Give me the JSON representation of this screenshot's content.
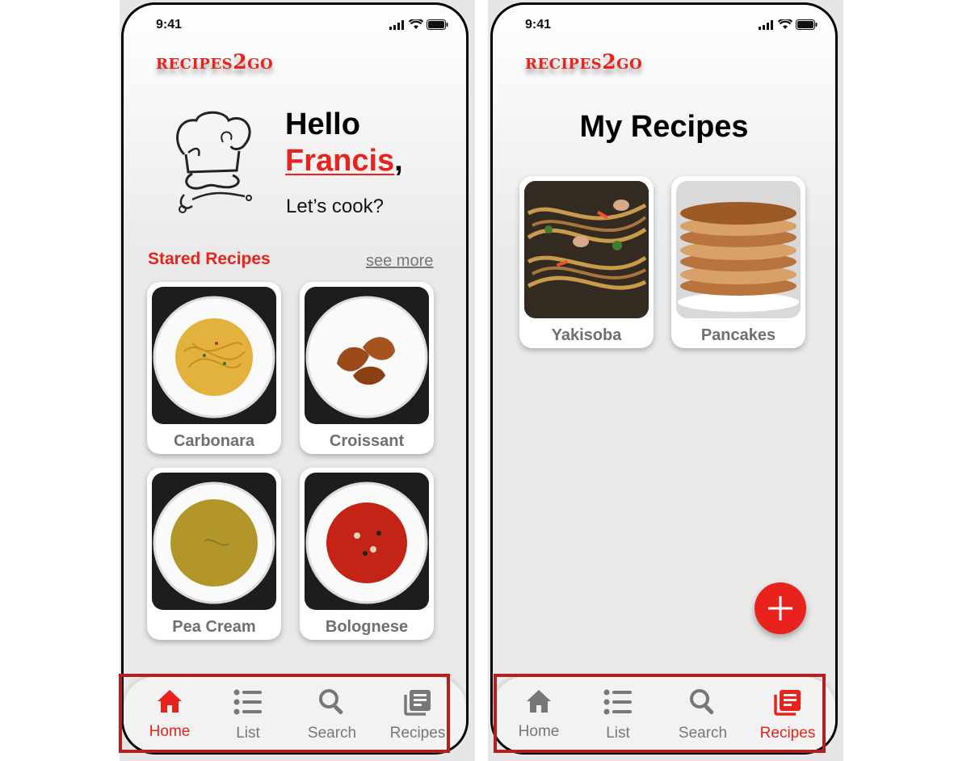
{
  "colors": {
    "accent": "#e8231d",
    "inactive": "#777777",
    "highlight_box": "#b21f1f"
  },
  "home_screen": {
    "status": {
      "time": "9:41"
    },
    "logo": {
      "prefix": "RECIPES",
      "digit": "2",
      "suffix": "GO"
    },
    "greeting": {
      "hello": "Hello",
      "name": "Francis",
      "comma": ",",
      "subtitle": "Let’s cook?"
    },
    "section": {
      "title": "Stared Recipes",
      "see_more": "see more"
    },
    "recipes": [
      {
        "label": "Carbonara",
        "icon": "spaghetti-plate-image"
      },
      {
        "label": "Croissant",
        "icon": "croissant-plate-image"
      },
      {
        "label": "Pea Cream",
        "icon": "pea-soup-image"
      },
      {
        "label": "Bolognese",
        "icon": "bolognese-soup-image"
      }
    ],
    "tabs": [
      {
        "label": "Home",
        "icon": "home-icon",
        "active": true
      },
      {
        "label": "List",
        "icon": "list-icon",
        "active": false
      },
      {
        "label": "Search",
        "icon": "search-icon",
        "active": false
      },
      {
        "label": "Recipes",
        "icon": "recipes-book-icon",
        "active": false
      }
    ]
  },
  "recipes_screen": {
    "status": {
      "time": "9:41"
    },
    "logo": {
      "prefix": "RECIPES",
      "digit": "2",
      "suffix": "GO"
    },
    "page_title": "My Recipes",
    "recipes": [
      {
        "label": "Yakisoba",
        "icon": "yakisoba-image"
      },
      {
        "label": "Pancakes",
        "icon": "pancakes-image"
      }
    ],
    "fab_icon": "plus-icon",
    "tabs": [
      {
        "label": "Home",
        "icon": "home-icon",
        "active": false
      },
      {
        "label": "List",
        "icon": "list-icon",
        "active": false
      },
      {
        "label": "Search",
        "icon": "search-icon",
        "active": false
      },
      {
        "label": "Recipes",
        "icon": "recipes-book-icon",
        "active": true
      }
    ]
  }
}
